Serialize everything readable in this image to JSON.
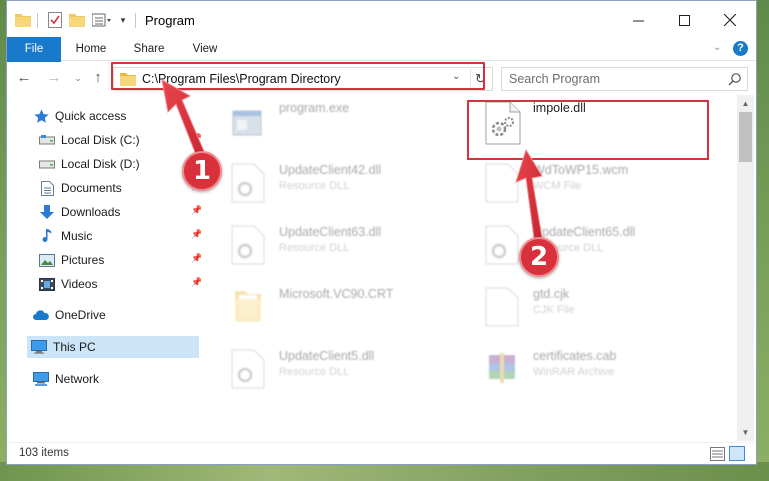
{
  "window": {
    "title": "Program",
    "min_icon": "minimize-icon",
    "max_icon": "maximize-icon",
    "close_icon": "close-icon"
  },
  "ribbon": {
    "tabs": [
      {
        "label": "File"
      },
      {
        "label": "Home"
      },
      {
        "label": "Share"
      },
      {
        "label": "View"
      }
    ]
  },
  "address": {
    "path": "C:\\Program Files\\Program Directory"
  },
  "search": {
    "placeholder": "Search Program"
  },
  "sidebar": {
    "items": [
      {
        "label": "Quick access",
        "icon": "star-icon"
      },
      {
        "label": "Local Disk (C:)",
        "icon": "drive-icon"
      },
      {
        "label": "Local Disk (D:)",
        "icon": "drive-icon"
      },
      {
        "label": "Documents",
        "icon": "documents-icon"
      },
      {
        "label": "Downloads",
        "icon": "downloads-icon"
      },
      {
        "label": "Music",
        "icon": "music-icon"
      },
      {
        "label": "Pictures",
        "icon": "pictures-icon"
      },
      {
        "label": "Videos",
        "icon": "videos-icon"
      },
      {
        "label": "OneDrive",
        "icon": "cloud-icon"
      },
      {
        "label": "This PC",
        "icon": "computer-icon"
      },
      {
        "label": "Network",
        "icon": "network-icon"
      }
    ]
  },
  "files": [
    {
      "name": "program.exe",
      "type": ""
    },
    {
      "name": "impole.dll",
      "type": ""
    },
    {
      "name": "UpdateClient42.dll",
      "type": "Resource DLL"
    },
    {
      "name": "WdToWP15.wcm",
      "type": "WCM File"
    },
    {
      "name": "UpdateClient63.dll",
      "type": "Resource DLL"
    },
    {
      "name": "UpdateClient65.dll",
      "type": "Resource DLL"
    },
    {
      "name": "Microsoft.VC90.CRT",
      "type": ""
    },
    {
      "name": "gtd.cjk",
      "type": "CJK File"
    },
    {
      "name": "UpdateClient5.dll",
      "type": "Resource DLL"
    },
    {
      "name": "certificates.cab",
      "type": "WinRAR Archive"
    }
  ],
  "status": {
    "item_count": "103 items"
  },
  "annotations": {
    "step1": "1",
    "step2": "2",
    "color": "#d9313b"
  },
  "colors": {
    "accent": "#1979ca",
    "selection": "#cce4f7"
  }
}
